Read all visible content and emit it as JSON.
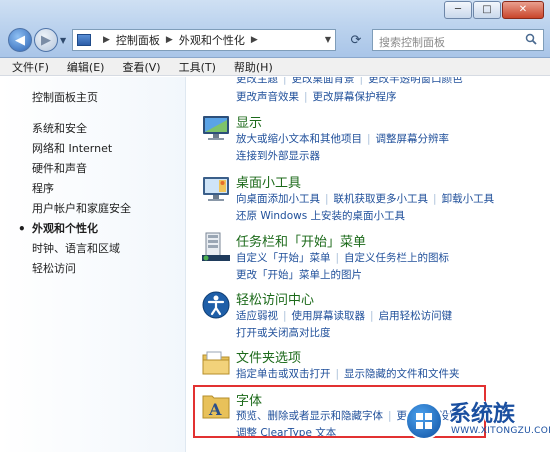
{
  "window": {
    "minimize": "─",
    "maximize": "□",
    "close": "✕"
  },
  "breadcrumb": [
    "控制面板",
    "外观和个性化"
  ],
  "search": {
    "placeholder": "搜索控制面板"
  },
  "menu": [
    "文件(F)",
    "编辑(E)",
    "查看(V)",
    "工具(T)",
    "帮助(H)"
  ],
  "left": {
    "home": "控制面板主页",
    "items": [
      "系统和安全",
      "网络和 Internet",
      "硬件和声音",
      "程序",
      "用户帐户和家庭安全",
      "外观和个性化",
      "时钟、语言和区域",
      "轻松访问"
    ],
    "current_index": 5
  },
  "categories": [
    {
      "title": "",
      "links": [
        [
          "更改主题",
          "更改桌面背景",
          "更改半透明窗口颜色"
        ],
        [
          "更改声音效果",
          "更改屏幕保护程序"
        ]
      ]
    },
    {
      "title": "显示",
      "links": [
        [
          "放大或缩小文本和其他项目",
          "调整屏幕分辨率"
        ],
        [
          "连接到外部显示器"
        ]
      ]
    },
    {
      "title": "桌面小工具",
      "links": [
        [
          "向桌面添加小工具",
          "联机获取更多小工具",
          "卸载小工具"
        ],
        [
          "还原 Windows 上安装的桌面小工具"
        ]
      ]
    },
    {
      "title": "任务栏和「开始」菜单",
      "links": [
        [
          "自定义「开始」菜单",
          "自定义任务栏上的图标"
        ],
        [
          "更改「开始」菜单上的图片"
        ]
      ]
    },
    {
      "title": "轻松访问中心",
      "links": [
        [
          "适应弱视",
          "使用屏幕读取器",
          "启用轻松访问键"
        ],
        [
          "打开或关闭高对比度"
        ]
      ]
    },
    {
      "title": "文件夹选项",
      "links": [
        [
          "指定单击或双击打开",
          "显示隐藏的文件和文件夹"
        ]
      ]
    },
    {
      "title": "字体",
      "links": [
        [
          "预览、删除或者显示和隐藏字体",
          "更改字体设置"
        ],
        [
          "调整 ClearType 文本"
        ]
      ]
    }
  ],
  "watermark": {
    "title": "系统族",
    "url": "WWW.XITONGZU.COM"
  }
}
